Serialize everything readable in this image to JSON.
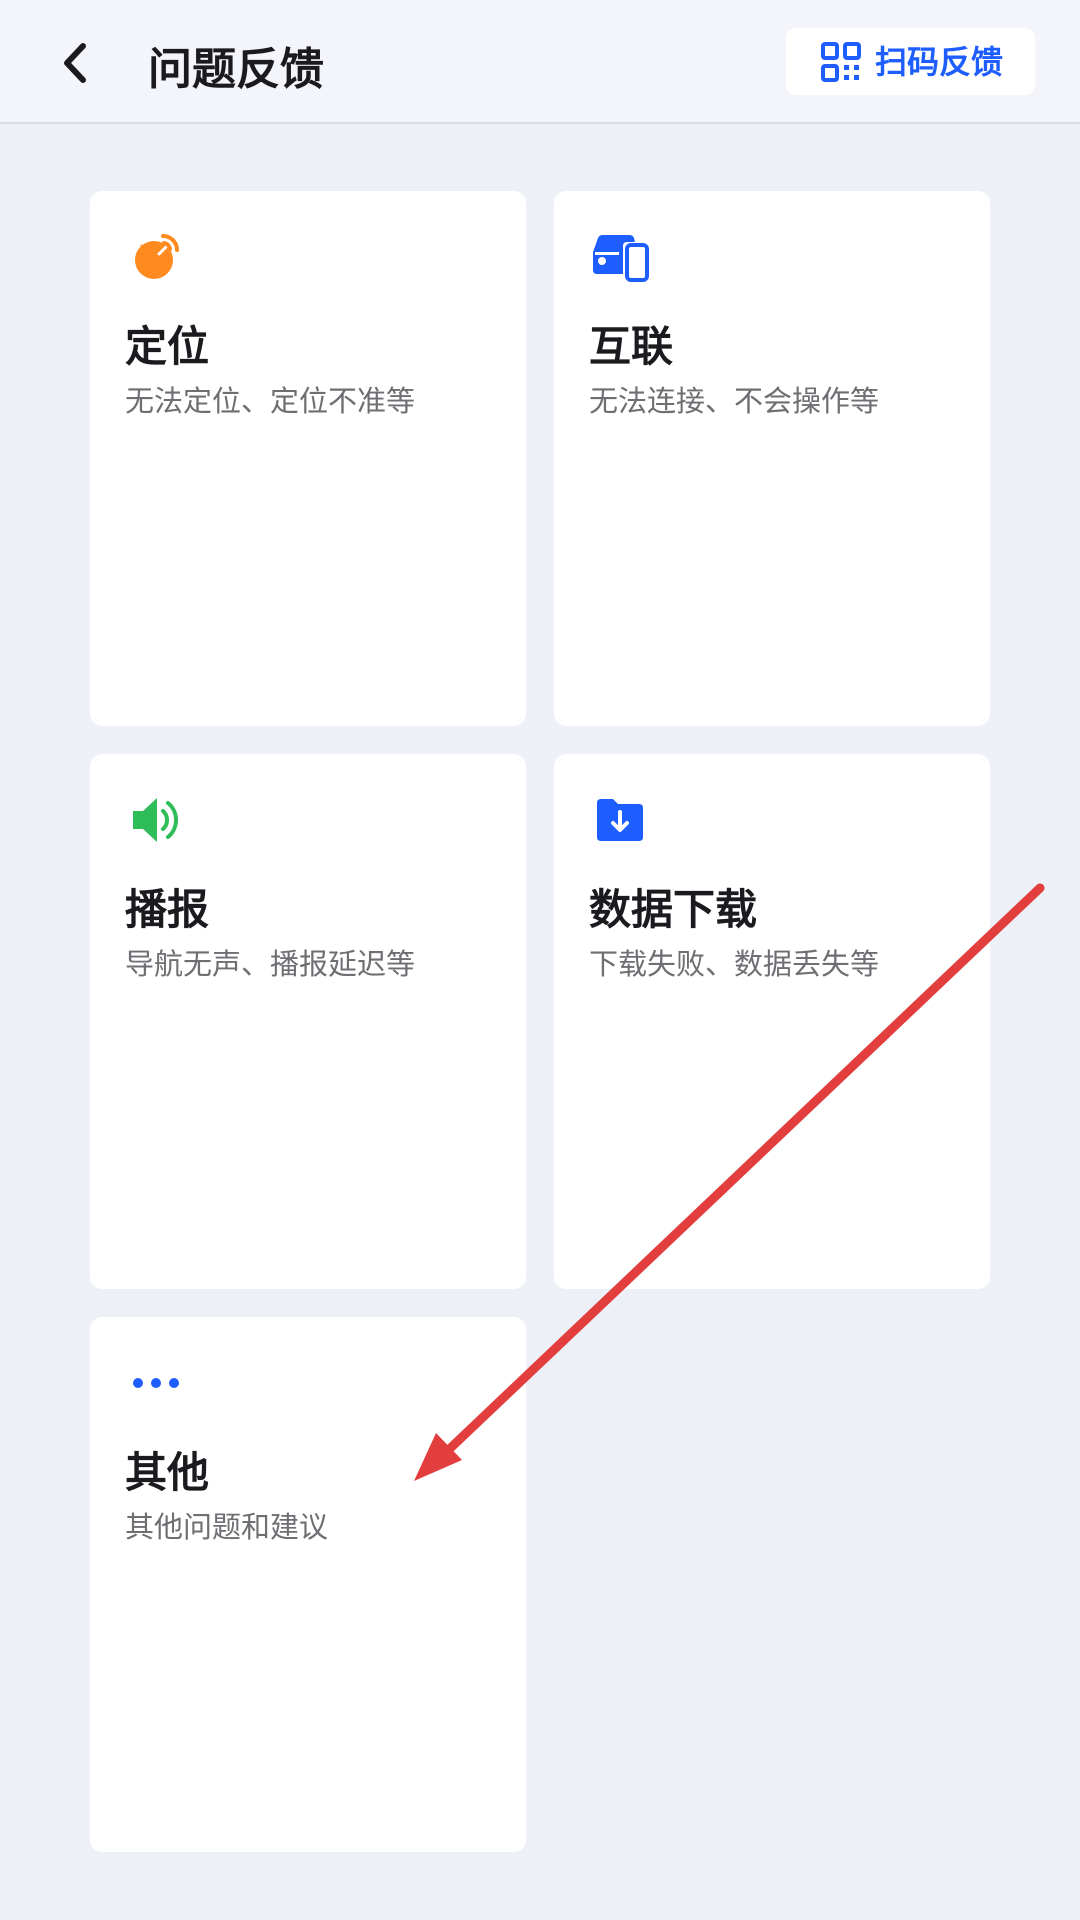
{
  "header": {
    "title": "问题反馈",
    "scan_label": "扫码反馈"
  },
  "cards": [
    {
      "title": "定位",
      "desc": "无法定位、定位不准等",
      "icon": "satellite-dish-icon",
      "color": "#ff8a1f"
    },
    {
      "title": "互联",
      "desc": "无法连接、不会操作等",
      "icon": "car-phone-icon",
      "color": "#1e5eff"
    },
    {
      "title": "播报",
      "desc": "导航无声、播报延迟等",
      "icon": "speaker-icon",
      "color": "#2ebd59"
    },
    {
      "title": "数据下载",
      "desc": "下载失败、数据丢失等",
      "icon": "folder-download-icon",
      "color": "#1e5eff"
    },
    {
      "title": "其他",
      "desc": "其他问题和建议",
      "icon": "more-dots-icon",
      "color": "#1e5eff"
    }
  ],
  "colors": {
    "accent": "#1e5eff",
    "annotation_arrow": "#e33e3e",
    "background": "#eef0f8"
  }
}
